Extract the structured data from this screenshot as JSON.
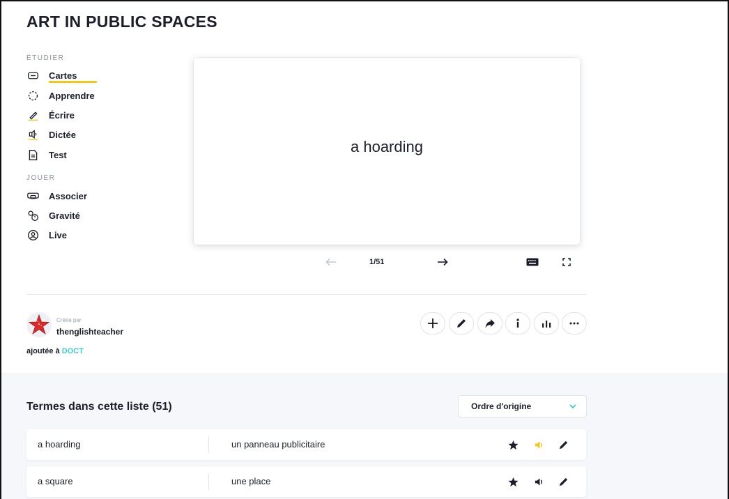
{
  "title": "ART IN PUBLIC SPACES",
  "study": {
    "label": "ÉTUDIER",
    "items": [
      {
        "label": "Cartes",
        "icon": "cards-icon"
      },
      {
        "label": "Apprendre",
        "icon": "learn-icon"
      },
      {
        "label": "Écrire",
        "icon": "pen-icon"
      },
      {
        "label": "Dictée",
        "icon": "speaker-icon"
      },
      {
        "label": "Test",
        "icon": "document-icon"
      }
    ]
  },
  "play": {
    "label": "JOUER",
    "items": [
      {
        "label": "Associer",
        "icon": "match-icon"
      },
      {
        "label": "Gravité",
        "icon": "gravity-icon"
      },
      {
        "label": "Live",
        "icon": "live-icon"
      }
    ]
  },
  "flashcard": {
    "term": "a hoarding",
    "counter": "1/51"
  },
  "author": {
    "created_by": "Créée par",
    "name": "thenglishteacher",
    "added_prefix": "ajoutée à",
    "added_link": "DOCT"
  },
  "terms": {
    "title": "Termes dans cette liste (51)",
    "sort_label": "Ordre d'origine",
    "rows": [
      {
        "term": "a hoarding",
        "definition": "un panneau publicitaire",
        "audio_color": "#f5c518"
      },
      {
        "term": "a square",
        "definition": "une place",
        "audio_color": "#1c1f2b"
      }
    ]
  },
  "colors": {
    "accent": "#f5c518",
    "link": "#3ccfcf",
    "text": "#1c1f2b"
  }
}
